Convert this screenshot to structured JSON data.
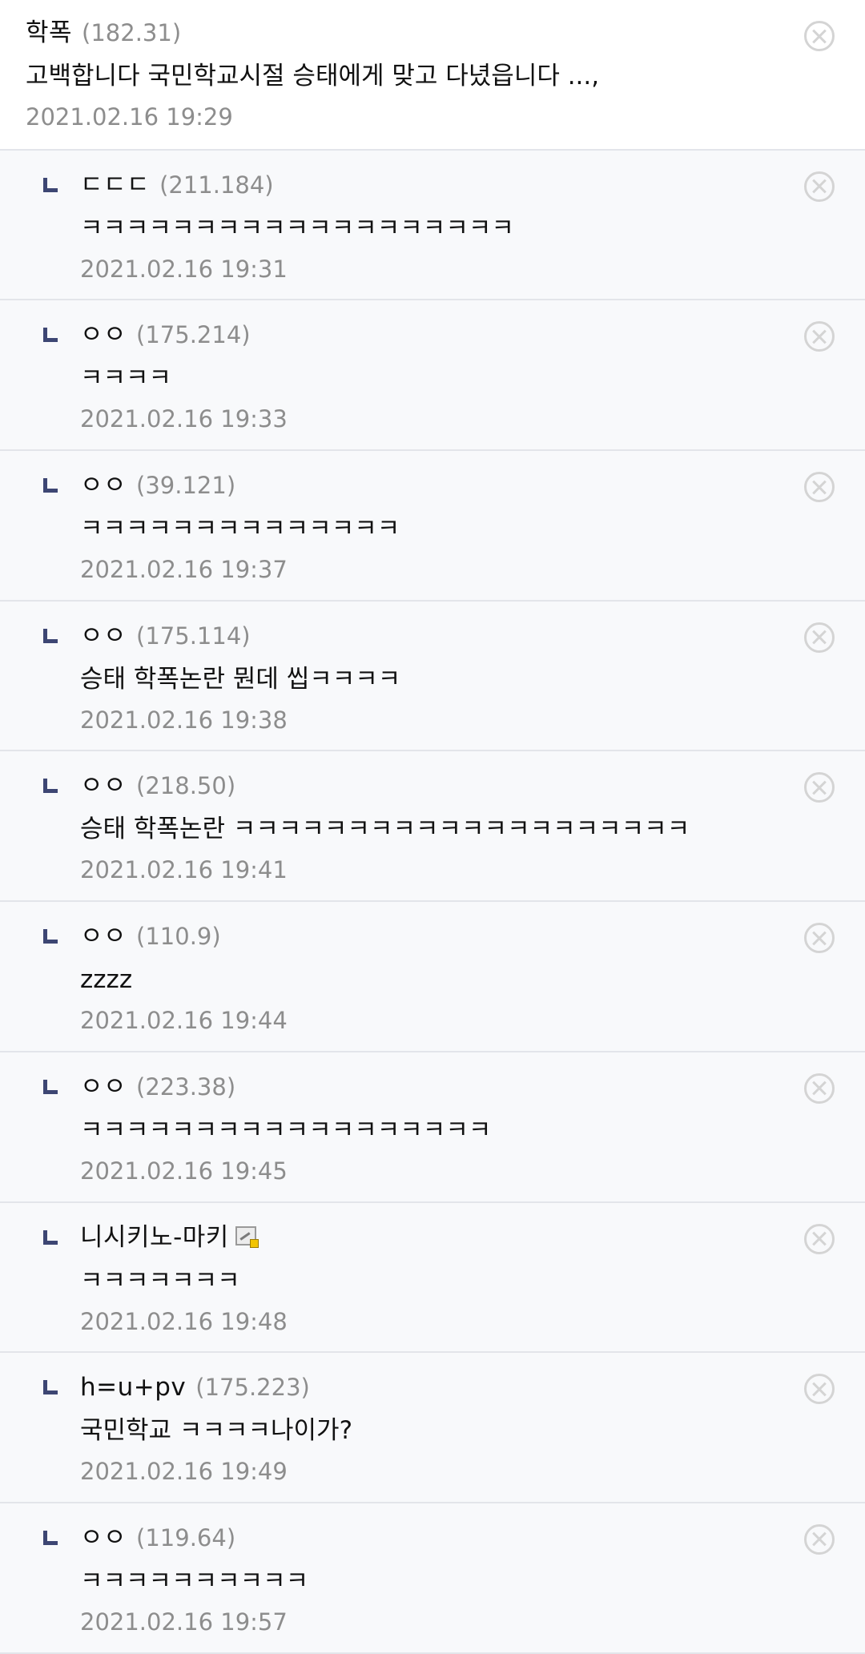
{
  "comments": [
    {
      "nick": "학폭",
      "ip": "(182.31)",
      "text": "고백합니다 국민학교시절 승태에게 맞고 다녔읍니다 ...,",
      "date": "2021.02.16 19:29"
    },
    {
      "nick": "ㄷㄷㄷ",
      "ip": "(211.184)",
      "text": "ㅋㅋㅋㅋㅋㅋㅋㅋㅋㅋㅋㅋㅋㅋㅋㅋㅋㅋㅋ",
      "date": "2021.02.16 19:31"
    },
    {
      "nick": "ㅇㅇ",
      "ip": "(175.214)",
      "text": "ㅋㅋㅋㅋ",
      "date": "2021.02.16 19:33"
    },
    {
      "nick": "ㅇㅇ",
      "ip": "(39.121)",
      "text": "ㅋㅋㅋㅋㅋㅋㅋㅋㅋㅋㅋㅋㅋㅋ",
      "date": "2021.02.16 19:37"
    },
    {
      "nick": "ㅇㅇ",
      "ip": "(175.114)",
      "text": "승태 학폭논란 뭔데 씹ㅋㅋㅋㅋ",
      "date": "2021.02.16 19:38"
    },
    {
      "nick": "ㅇㅇ",
      "ip": "(218.50)",
      "text": "승태 학폭논란 ㅋㅋㅋㅋㅋㅋㅋㅋㅋㅋㅋㅋㅋㅋㅋㅋㅋㅋㅋㅋ",
      "date": "2021.02.16 19:41"
    },
    {
      "nick": "ㅇㅇ",
      "ip": "(110.9)",
      "text": "zzzz",
      "date": "2021.02.16 19:44"
    },
    {
      "nick": "ㅇㅇ",
      "ip": "(223.38)",
      "text": "ㅋㅋㅋㅋㅋㅋㅋㅋㅋㅋㅋㅋㅋㅋㅋㅋㅋㅋ",
      "date": "2021.02.16 19:45"
    },
    {
      "nick": "니시키노-마키",
      "ip": "",
      "text": "ㅋㅋㅋㅋㅋㅋㅋ",
      "date": "2021.02.16 19:48",
      "icon": "fixed-nick-member-icon"
    },
    {
      "nick": "h=u+pv",
      "ip": "(175.223)",
      "text": "국민학교 ㅋㅋㅋㅋ나이가?",
      "date": "2021.02.16 19:49"
    },
    {
      "nick": "ㅇㅇ",
      "ip": "(119.64)",
      "text": "ㅋㅋㅋㅋㅋㅋㅋㅋㅋㅋ",
      "date": "2021.02.16 19:57"
    }
  ],
  "icons": {
    "reply": "reply-arrow-icon",
    "delete": "delete-x-circle-icon"
  },
  "colors": {
    "reply_arrow": "#3d4673",
    "meta_text": "#8d8d8d",
    "reply_background": "#f8f9fb",
    "divider": "#e3e5ea"
  }
}
